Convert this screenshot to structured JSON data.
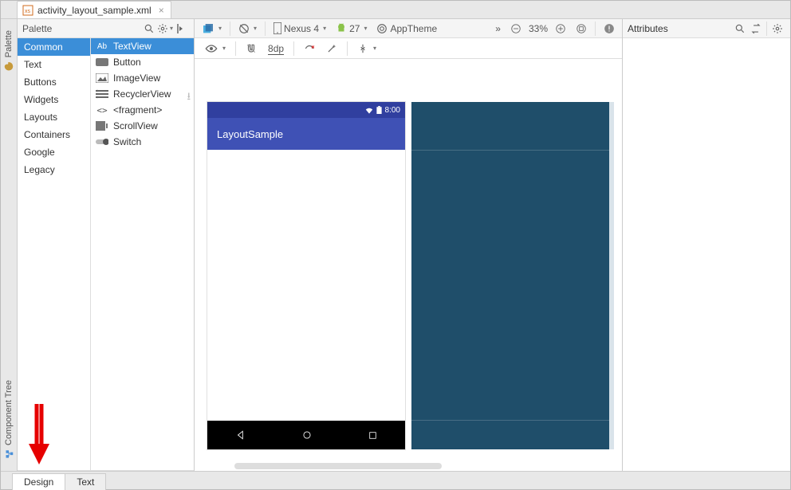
{
  "file_tab": {
    "name": "activity_layout_sample.xml",
    "close": "×"
  },
  "vertical_rails": {
    "palette": "Palette",
    "component_tree": "Component Tree"
  },
  "palette": {
    "title": "Palette",
    "categories": [
      "Common",
      "Text",
      "Buttons",
      "Widgets",
      "Layouts",
      "Containers",
      "Google",
      "Legacy"
    ],
    "components": [
      {
        "icon": "Ab",
        "label": "TextView"
      },
      {
        "icon": "btn",
        "label": "Button"
      },
      {
        "icon": "img",
        "label": "ImageView"
      },
      {
        "icon": "list",
        "label": "RecyclerView"
      },
      {
        "icon": "frag",
        "label": "<fragment>"
      },
      {
        "icon": "scroll",
        "label": "ScrollView"
      },
      {
        "icon": "switch",
        "label": "Switch"
      }
    ]
  },
  "design_toolbar": {
    "device": "Nexus 4",
    "api": "27",
    "theme": "AppTheme",
    "zoom": "33%",
    "more": "»"
  },
  "design_toolbar2": {
    "dp": "8dp"
  },
  "device_preview": {
    "status_time": "8:00",
    "app_title": "LayoutSample",
    "nav": {
      "back": "◁",
      "home": "○",
      "recent": "□"
    }
  },
  "attributes": {
    "title": "Attributes"
  },
  "bottom_tabs": {
    "design": "Design",
    "text": "Text"
  }
}
